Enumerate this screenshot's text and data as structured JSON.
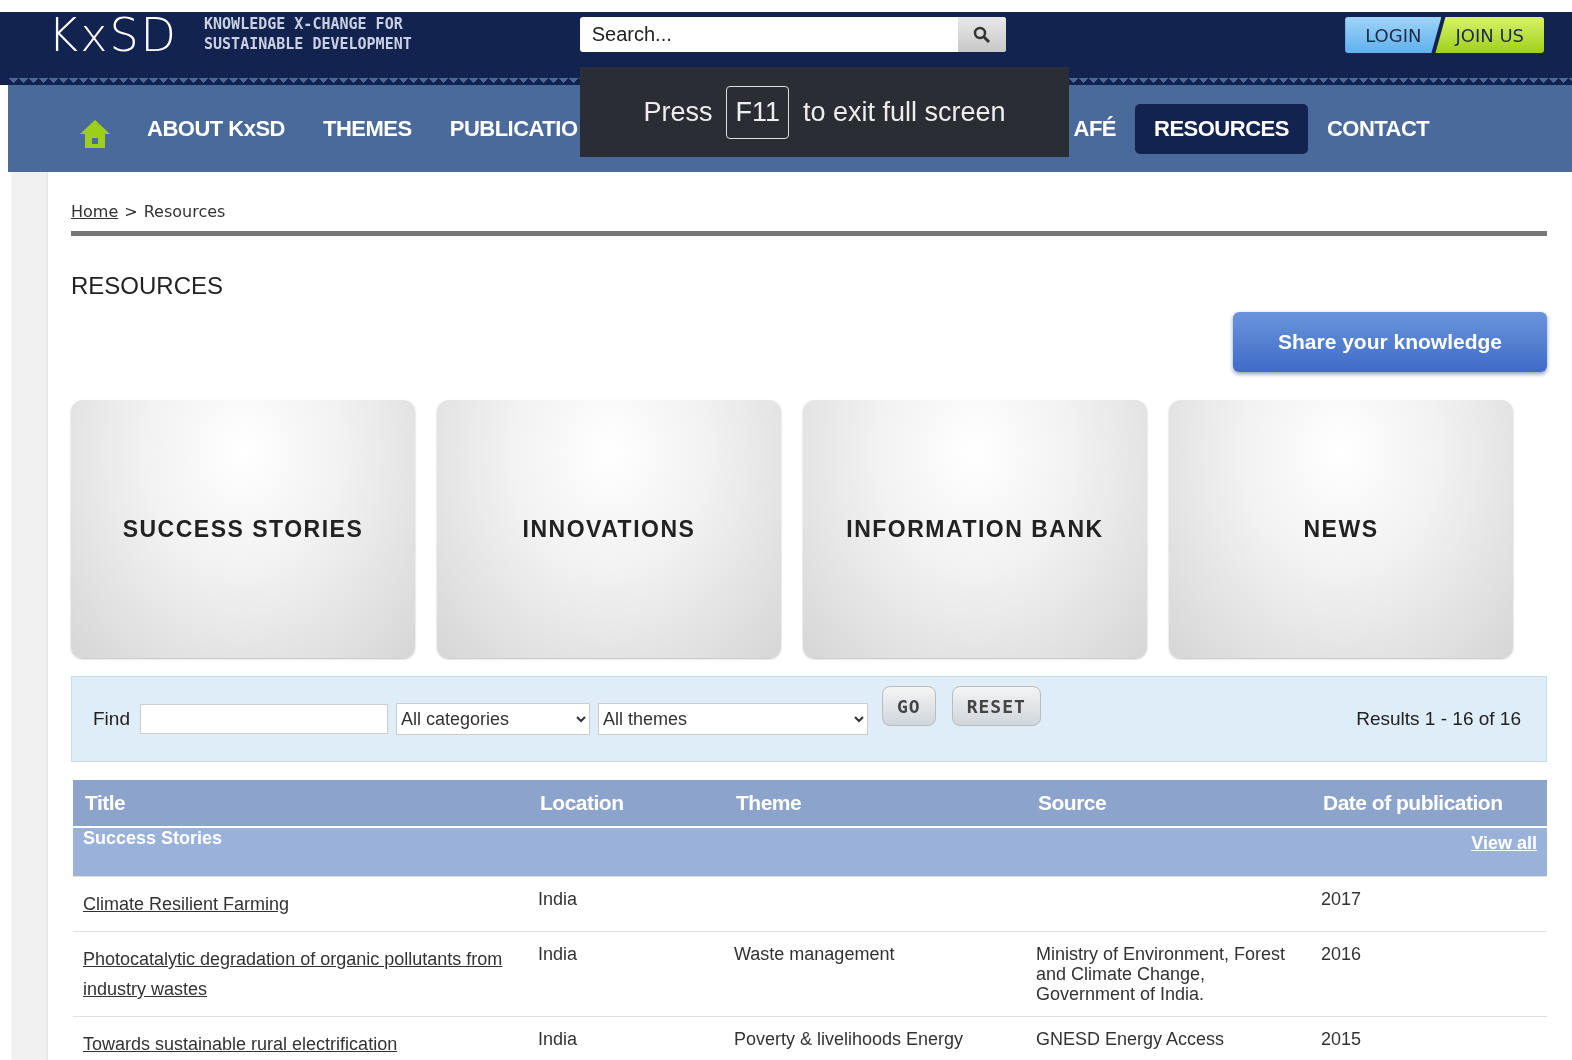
{
  "header": {
    "logo": "KxSD",
    "tagline_1": "KNOWLEDGE X-CHANGE FOR",
    "tagline_2": "SUSTAINABLE DEVELOPMENT",
    "search": {
      "placeholder": "Search..."
    },
    "login": "LOGIN",
    "join": "JOIN US"
  },
  "nav": {
    "items": [
      {
        "label": "ABOUT KxSD",
        "selected": false
      },
      {
        "label": "THEMES",
        "selected": false
      },
      {
        "label": "PUBLICATIO",
        "selected": false
      },
      {
        "label": "AFÉ",
        "selected": false
      },
      {
        "label": "RESOURCES",
        "selected": true
      },
      {
        "label": "CONTACT",
        "selected": false
      }
    ]
  },
  "fullscreen_notice": {
    "before": "Press",
    "key": "F11",
    "after": "to exit full screen"
  },
  "breadcrumb": [
    {
      "label": "Home",
      "kind": "link"
    },
    {
      "label": ">",
      "kind": "sep"
    },
    {
      "label": "Resources",
      "kind": "current"
    }
  ],
  "page_title": "RESOURCES",
  "share_button": "Share your knowledge",
  "tiles": [
    "SUCCESS STORIES",
    "INNOVATIONS",
    "INFORMATION BANK",
    "NEWS"
  ],
  "filter": {
    "find_label": "Find",
    "categories": "All categories",
    "themes": "All themes",
    "go": "GO",
    "reset": "RESET",
    "results": "Results 1 - 16 of 16"
  },
  "table": {
    "columns": [
      "Title",
      "Location",
      "Theme",
      "Source",
      "Date of publication"
    ],
    "group": {
      "title": "Success Stories",
      "link": "View all"
    },
    "rows": [
      {
        "title": "Climate Resilient Farming",
        "location": "India",
        "date": "2017"
      },
      {
        "title": "Photocatalytic degradation of organic pollutants from industry wastes",
        "location": "India",
        "theme": "Waste management",
        "source": "Ministry of Environment, Forest and Climate Change, Government of India.",
        "date": "2016"
      },
      {
        "title": "Towards sustainable rural electrification",
        "location": "India",
        "theme": "Poverty & livelihoods Energy",
        "source": "GNESD Energy Access",
        "date": "2015"
      }
    ]
  }
}
